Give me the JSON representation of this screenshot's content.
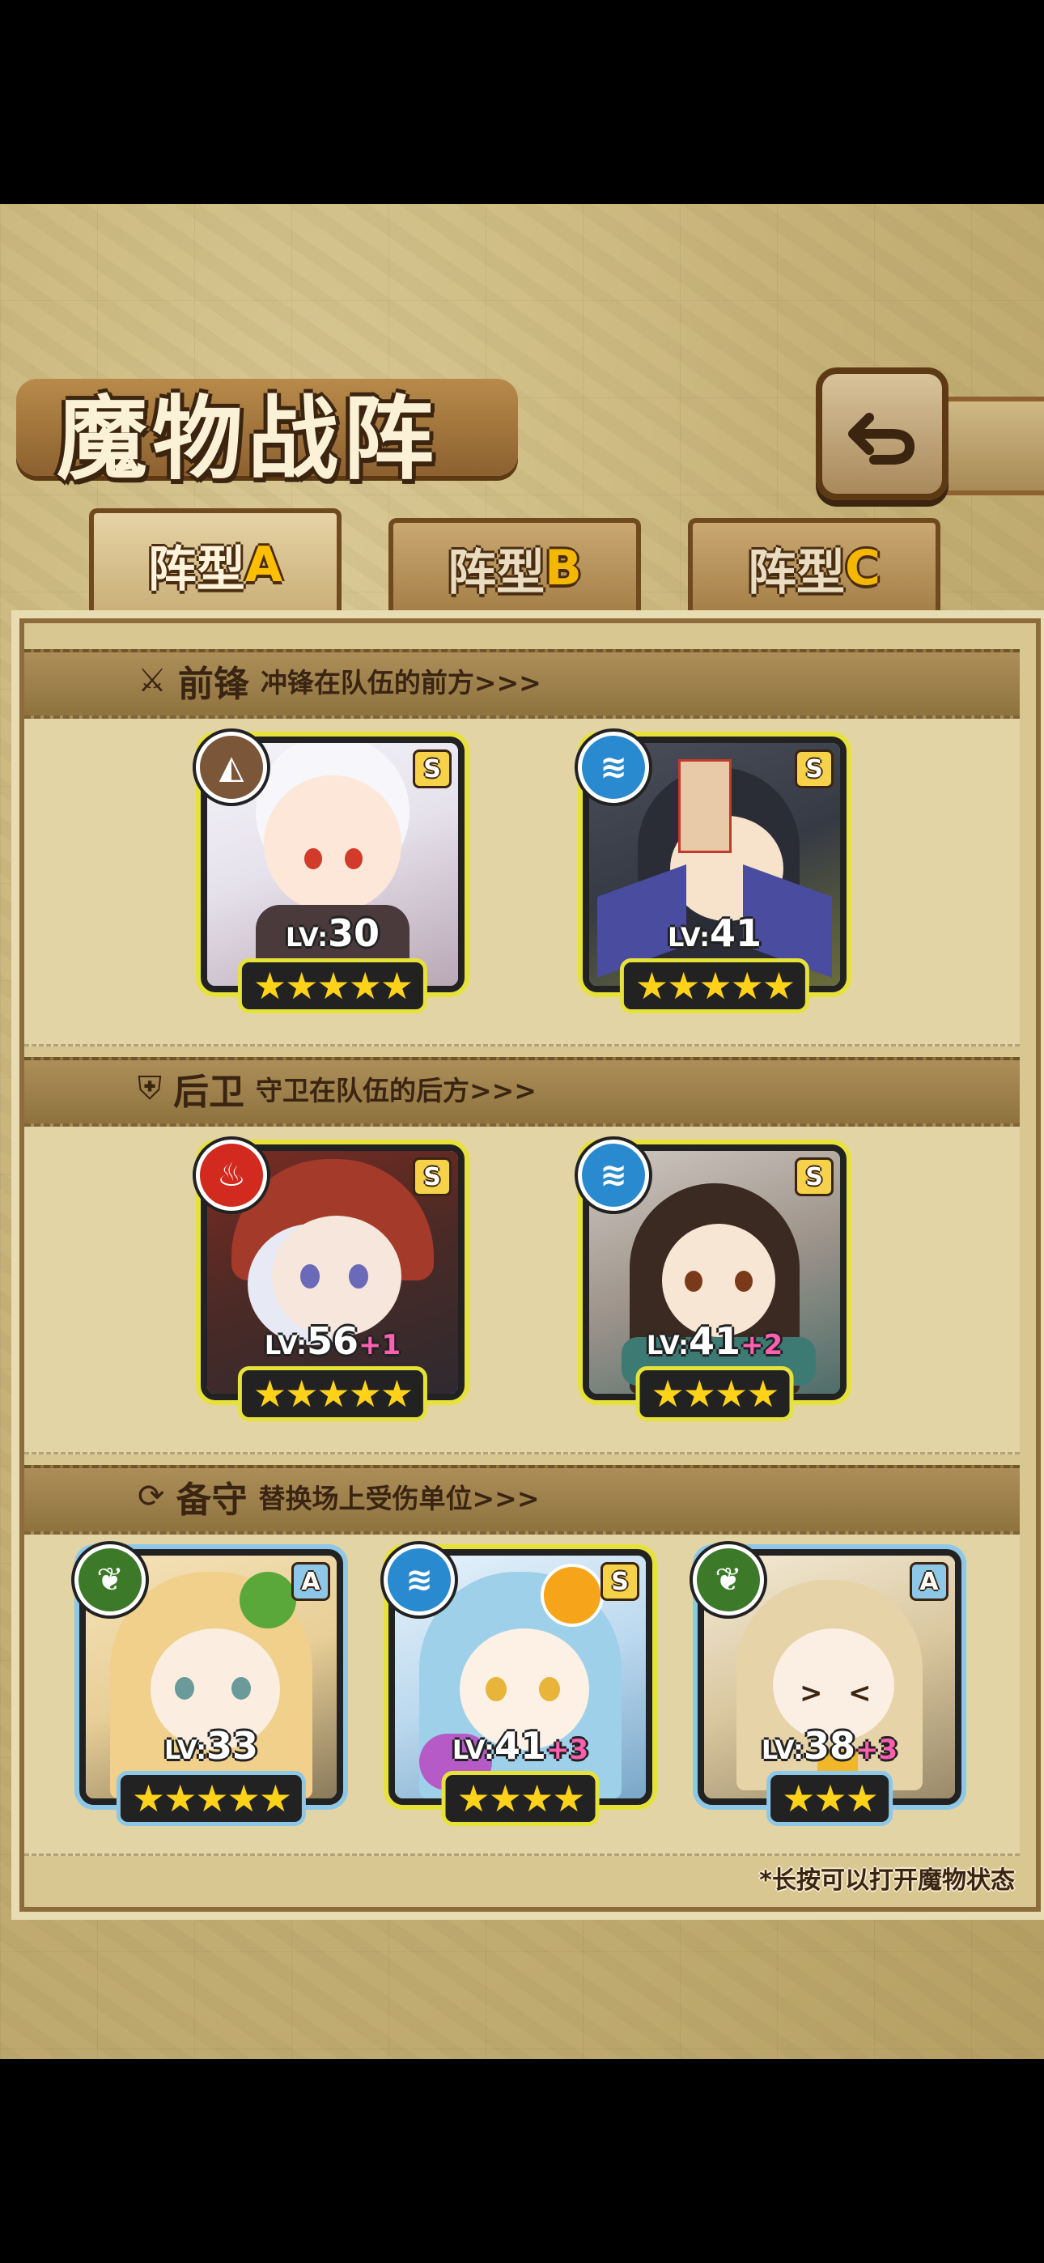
{
  "header": {
    "title": "魔物战阵"
  },
  "tabs": [
    {
      "label": "阵型",
      "letter": "A",
      "active": true
    },
    {
      "label": "阵型",
      "letter": "B",
      "active": false
    },
    {
      "label": "阵型",
      "letter": "C",
      "active": false
    }
  ],
  "sections": {
    "front": {
      "title": "前锋",
      "subtitle": "冲锋在队伍的前方>>>",
      "icon": "sword-icon"
    },
    "rear": {
      "title": "后卫",
      "subtitle": "守卫在队伍的后方>>>",
      "icon": "shield-icon"
    },
    "reserve": {
      "title": "备守",
      "subtitle": "替换场上受伤单位>>>",
      "icon": "swap-icon"
    }
  },
  "units": {
    "front": [
      {
        "element": "earth",
        "rank": "S",
        "lv": "30",
        "bonus": "",
        "stars": 5
      },
      {
        "element": "water",
        "rank": "S",
        "lv": "41",
        "bonus": "",
        "stars": 5
      }
    ],
    "rear": [
      {
        "element": "fire",
        "rank": "S",
        "lv": "56",
        "bonus": "+1",
        "stars": 5
      },
      {
        "element": "water",
        "rank": "S",
        "lv": "41",
        "bonus": "+2",
        "stars": 4
      }
    ],
    "reserve": [
      {
        "element": "wind",
        "rank": "A",
        "lv": "33",
        "bonus": "",
        "stars": 5
      },
      {
        "element": "water",
        "rank": "S",
        "lv": "41",
        "bonus": "+3",
        "stars": 4
      },
      {
        "element": "wind",
        "rank": "A",
        "lv": "38",
        "bonus": "+3",
        "stars": 3
      }
    ]
  },
  "lv_prefix": "LV:",
  "footnote": "*长按可以打开魔物状态",
  "colors": {
    "s_frame": "#e7e23a",
    "a_frame": "#8dc8e8",
    "plus": "#ff5fb0",
    "earth": "#7b5638",
    "water": "#2a8ad0",
    "fire": "#d22a1e",
    "wind": "#3c7a2a"
  }
}
